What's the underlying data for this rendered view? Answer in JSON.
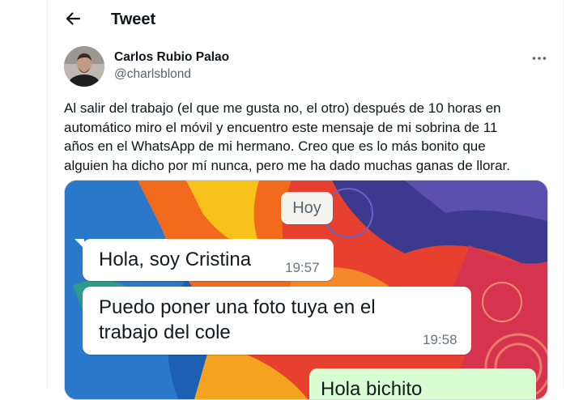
{
  "header": {
    "back_icon": "arrow-left-icon",
    "title": "Tweet"
  },
  "tweet": {
    "author_name": "Carlos Rubio Palao",
    "author_handle": "@charlsblond",
    "more_icon": "more-horizontal-icon",
    "text": "Al salir del trabajo (el que me gusta no, el otro) después de 10 horas en\nautomático miro el móvil y encuentro este mensaje de mi sobrina de 11\naños en el WhatsApp de mi hermano. Creo que es lo más bonito que\nalguien ha dicho por mí nunca, pero me ha dado muchas ganas de llorar."
  },
  "media": {
    "date_chip": "Hoy",
    "messages": [
      {
        "text": "Hola, soy Cristina",
        "time": "19:57",
        "direction": "incoming"
      },
      {
        "text": "Puedo poner una foto tuya en el\ntrabajo del cole",
        "time": "19:58",
        "direction": "incoming"
      },
      {
        "text": "Hola bichito",
        "time": "",
        "direction": "outgoing"
      }
    ]
  },
  "colors": {
    "text_primary": "#0f1419",
    "text_secondary": "#536471",
    "border": "#eff3f4",
    "whatsapp_outgoing": "#d9fdd3"
  }
}
